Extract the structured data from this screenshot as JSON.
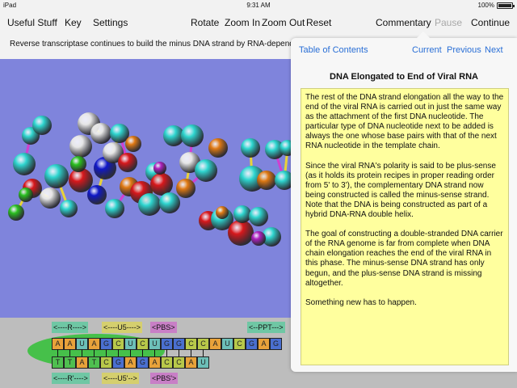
{
  "status_bar": {
    "device": "iPad",
    "time": "9:31 AM",
    "battery": "100%"
  },
  "toolbar": {
    "useful_stuff": "Useful Stuff",
    "key": "Key",
    "settings": "Settings",
    "rotate": "Rotate",
    "zoom_in": "Zoom In",
    "zoom_out": "Zoom Out",
    "reset": "Reset",
    "commentary": "Commentary",
    "pause": "Pause",
    "continue": "Continue"
  },
  "caption": "Reverse transcriptase continues to build the minus DNA strand by RNA-depende",
  "commentary": {
    "nav": {
      "toc": "Table of Contents",
      "current": "Current",
      "previous": "Previous",
      "next": "Next"
    },
    "title": "DNA Elongated to End of Viral RNA",
    "paragraphs": [
      "The rest of the DNA strand elongation all the way to the end of the viral RNA is carried out in just the same way as the attachment of the first DNA nucleotide. The particular type of DNA nucleotide next to be added is always the one whose base pairs with that of the next RNA nucleotide in the template chain.",
      "Since the viral RNA's polarity is said to be plus-sense (as it holds its protein recipes in proper reading order from 5' to 3'), the complementary DNA strand now being constructed is called the minus-sense strand. Note that the DNA is being constructed as part of a hybrid DNA-RNA double helix.",
      "The goal of constructing a double-stranded DNA carrier of the RNA genome is far from complete when DNA chain elongation reaches the end of the viral RNA in this phase. The minus-sense DNA strand has only begun, and the plus-sense DNA strand is missing altogether.",
      "Something new has to happen."
    ]
  },
  "sequence": {
    "top_labels": [
      "<----R---->",
      "<----U5---->",
      "<PBS>",
      "<--PPT--->"
    ],
    "rna": [
      "A",
      "A",
      "U",
      "A",
      "G",
      "C",
      "U",
      "C",
      "U",
      "G",
      "G",
      "C",
      "C",
      "A",
      "U",
      "C",
      "G",
      "A",
      "G"
    ],
    "dna": [
      "T",
      "T",
      "A",
      "T",
      "C",
      "G",
      "A",
      "G",
      "A",
      "C",
      "C",
      "A",
      "U"
    ],
    "bottom_labels": [
      "<----R'---->",
      "<----U5'-->",
      "<PBS'>"
    ]
  },
  "colors": {
    "A": "#e8a23a",
    "U": "#6cbfb8",
    "G": "#4a6fd0",
    "C": "#b8c84a",
    "T": "#4fbf50"
  }
}
